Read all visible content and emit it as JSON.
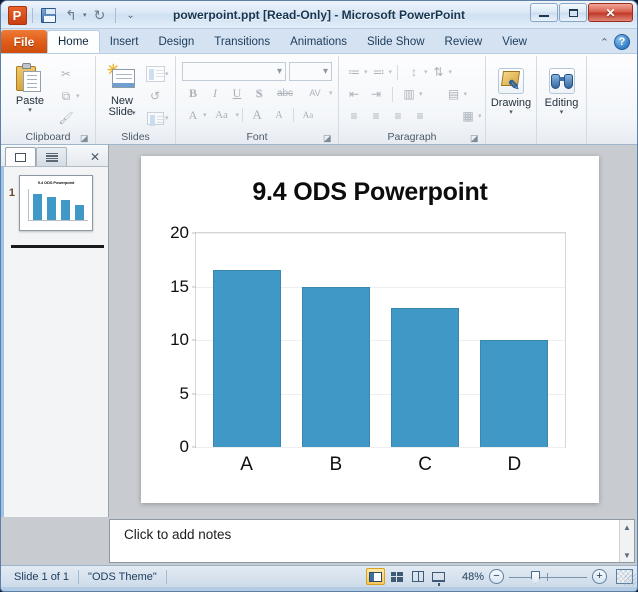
{
  "window": {
    "title": "powerpoint.ppt [Read-Only]  -  Microsoft PowerPoint",
    "app_logo": "powerpoint-logo-icon",
    "minimize_label": "",
    "maximize_label": "",
    "close_label": "✕"
  },
  "qat": {
    "items": [
      {
        "name": "save-icon",
        "label": ""
      },
      {
        "name": "undo-icon",
        "label": "↰"
      },
      {
        "name": "undo-dropdown-icon",
        "label": "▾"
      },
      {
        "name": "redo-icon",
        "label": "↻"
      },
      {
        "name": "customize-qat-icon",
        "label": "▾"
      }
    ]
  },
  "ribbon": {
    "file_tab": "File",
    "tabs": [
      {
        "label": "Home",
        "active": true
      },
      {
        "label": "Insert",
        "active": false
      },
      {
        "label": "Design",
        "active": false
      },
      {
        "label": "Transitions",
        "active": false
      },
      {
        "label": "Animations",
        "active": false
      },
      {
        "label": "Slide Show",
        "active": false
      },
      {
        "label": "Review",
        "active": false
      },
      {
        "label": "View",
        "active": false
      }
    ],
    "minimize_ribbon_icon": "⌃",
    "help_icon": "?",
    "groups": {
      "clipboard": {
        "label": "Clipboard",
        "paste_label": "Paste",
        "paste_caret": "▾",
        "cut_icon": "✂",
        "copy_icon": "⧉",
        "copy_caret": "▾",
        "format_painter_icon": "🖌",
        "dialog_launcher": "◪"
      },
      "slides": {
        "label": "Slides",
        "new_slide_label": "New\nSlide",
        "new_slide_line1": "New",
        "new_slide_line2": "Slide",
        "new_slide_caret": "▾",
        "layout_caret": "▾",
        "reset_icon": "↺",
        "section_caret": "▾"
      },
      "font": {
        "label": "Font",
        "font_name_value": "",
        "font_name_placeholder": "",
        "font_size_value": "",
        "font_size_placeholder": "",
        "bold": "B",
        "italic": "I",
        "underline": "U",
        "shadow": "S",
        "strikethrough": "abc",
        "character_spacing": "AV",
        "font_color": "A",
        "change_case": "Aa",
        "grow_font": "A",
        "shrink_font": "A",
        "clear_formatting": "Aa",
        "dialog_launcher": "◪"
      },
      "paragraph": {
        "label": "Paragraph",
        "bullets": "≔",
        "numbering": "≕",
        "decrease_indent": "⇤",
        "increase_indent": "⇥",
        "line_spacing": "↕",
        "text_direction": "⇅",
        "align_text": "▤",
        "columns": "▥",
        "align_left": "≡",
        "align_center": "≡",
        "align_right": "≡",
        "justify": "≡",
        "convert_smartart": "▦",
        "dialog_launcher": "◪"
      },
      "drawing": {
        "label": "Drawing",
        "caret": "▾"
      },
      "editing": {
        "label": "Editing",
        "caret": "▾"
      }
    }
  },
  "slide_pane": {
    "tabs": [
      {
        "name": "slides-tab",
        "label": "",
        "active": true
      },
      {
        "name": "outline-tab",
        "label": "",
        "active": false
      }
    ],
    "close_label": "✕",
    "thumbnails": [
      {
        "number": "1",
        "title": "9.4 ODS Powerpoint"
      }
    ]
  },
  "notes": {
    "placeholder": "Click to add notes",
    "scroll_up": "▲",
    "scroll_down": "▼"
  },
  "status_bar": {
    "slide_counter": "Slide 1 of 1",
    "theme": "\"ODS Theme\"",
    "zoom_level": "48%",
    "zoom_out_label": "−",
    "zoom_in_label": "+",
    "views": [
      {
        "name": "view-normal",
        "label": "",
        "active": true
      },
      {
        "name": "view-slide-sorter",
        "label": "",
        "active": false
      },
      {
        "name": "view-reading",
        "label": "",
        "active": false
      },
      {
        "name": "view-slide-show",
        "label": "",
        "active": false
      }
    ],
    "fit_to_window_label": ""
  },
  "chart_data": {
    "type": "bar",
    "title": "9.4 ODS Powerpoint",
    "categories": [
      "A",
      "B",
      "C",
      "D"
    ],
    "values": [
      16.5,
      15,
      13,
      10
    ],
    "xlabel": "",
    "ylabel": "",
    "ylim": [
      0,
      20
    ],
    "yticks": [
      0,
      5,
      10,
      15,
      20
    ],
    "ytick_labels": [
      "0",
      "5",
      "10",
      "15",
      "20"
    ],
    "grid": true,
    "legend": false,
    "bar_color": "#4098c6",
    "bar_edge_color": "#3a87ad",
    "plot_bg": "#ffffff",
    "grid_color": "#eceef0"
  }
}
